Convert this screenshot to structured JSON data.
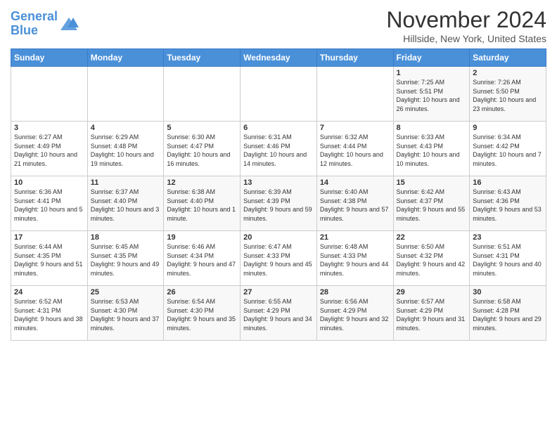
{
  "header": {
    "logo_line1": "General",
    "logo_line2": "Blue",
    "month": "November 2024",
    "location": "Hillside, New York, United States"
  },
  "days_of_week": [
    "Sunday",
    "Monday",
    "Tuesday",
    "Wednesday",
    "Thursday",
    "Friday",
    "Saturday"
  ],
  "weeks": [
    [
      {
        "num": "",
        "info": ""
      },
      {
        "num": "",
        "info": ""
      },
      {
        "num": "",
        "info": ""
      },
      {
        "num": "",
        "info": ""
      },
      {
        "num": "",
        "info": ""
      },
      {
        "num": "1",
        "info": "Sunrise: 7:25 AM\nSunset: 5:51 PM\nDaylight: 10 hours and 26 minutes."
      },
      {
        "num": "2",
        "info": "Sunrise: 7:26 AM\nSunset: 5:50 PM\nDaylight: 10 hours and 23 minutes."
      }
    ],
    [
      {
        "num": "3",
        "info": "Sunrise: 6:27 AM\nSunset: 4:49 PM\nDaylight: 10 hours and 21 minutes."
      },
      {
        "num": "4",
        "info": "Sunrise: 6:29 AM\nSunset: 4:48 PM\nDaylight: 10 hours and 19 minutes."
      },
      {
        "num": "5",
        "info": "Sunrise: 6:30 AM\nSunset: 4:47 PM\nDaylight: 10 hours and 16 minutes."
      },
      {
        "num": "6",
        "info": "Sunrise: 6:31 AM\nSunset: 4:46 PM\nDaylight: 10 hours and 14 minutes."
      },
      {
        "num": "7",
        "info": "Sunrise: 6:32 AM\nSunset: 4:44 PM\nDaylight: 10 hours and 12 minutes."
      },
      {
        "num": "8",
        "info": "Sunrise: 6:33 AM\nSunset: 4:43 PM\nDaylight: 10 hours and 10 minutes."
      },
      {
        "num": "9",
        "info": "Sunrise: 6:34 AM\nSunset: 4:42 PM\nDaylight: 10 hours and 7 minutes."
      }
    ],
    [
      {
        "num": "10",
        "info": "Sunrise: 6:36 AM\nSunset: 4:41 PM\nDaylight: 10 hours and 5 minutes."
      },
      {
        "num": "11",
        "info": "Sunrise: 6:37 AM\nSunset: 4:40 PM\nDaylight: 10 hours and 3 minutes."
      },
      {
        "num": "12",
        "info": "Sunrise: 6:38 AM\nSunset: 4:40 PM\nDaylight: 10 hours and 1 minute."
      },
      {
        "num": "13",
        "info": "Sunrise: 6:39 AM\nSunset: 4:39 PM\nDaylight: 9 hours and 59 minutes."
      },
      {
        "num": "14",
        "info": "Sunrise: 6:40 AM\nSunset: 4:38 PM\nDaylight: 9 hours and 57 minutes."
      },
      {
        "num": "15",
        "info": "Sunrise: 6:42 AM\nSunset: 4:37 PM\nDaylight: 9 hours and 55 minutes."
      },
      {
        "num": "16",
        "info": "Sunrise: 6:43 AM\nSunset: 4:36 PM\nDaylight: 9 hours and 53 minutes."
      }
    ],
    [
      {
        "num": "17",
        "info": "Sunrise: 6:44 AM\nSunset: 4:35 PM\nDaylight: 9 hours and 51 minutes."
      },
      {
        "num": "18",
        "info": "Sunrise: 6:45 AM\nSunset: 4:35 PM\nDaylight: 9 hours and 49 minutes."
      },
      {
        "num": "19",
        "info": "Sunrise: 6:46 AM\nSunset: 4:34 PM\nDaylight: 9 hours and 47 minutes."
      },
      {
        "num": "20",
        "info": "Sunrise: 6:47 AM\nSunset: 4:33 PM\nDaylight: 9 hours and 45 minutes."
      },
      {
        "num": "21",
        "info": "Sunrise: 6:48 AM\nSunset: 4:33 PM\nDaylight: 9 hours and 44 minutes."
      },
      {
        "num": "22",
        "info": "Sunrise: 6:50 AM\nSunset: 4:32 PM\nDaylight: 9 hours and 42 minutes."
      },
      {
        "num": "23",
        "info": "Sunrise: 6:51 AM\nSunset: 4:31 PM\nDaylight: 9 hours and 40 minutes."
      }
    ],
    [
      {
        "num": "24",
        "info": "Sunrise: 6:52 AM\nSunset: 4:31 PM\nDaylight: 9 hours and 38 minutes."
      },
      {
        "num": "25",
        "info": "Sunrise: 6:53 AM\nSunset: 4:30 PM\nDaylight: 9 hours and 37 minutes."
      },
      {
        "num": "26",
        "info": "Sunrise: 6:54 AM\nSunset: 4:30 PM\nDaylight: 9 hours and 35 minutes."
      },
      {
        "num": "27",
        "info": "Sunrise: 6:55 AM\nSunset: 4:29 PM\nDaylight: 9 hours and 34 minutes."
      },
      {
        "num": "28",
        "info": "Sunrise: 6:56 AM\nSunset: 4:29 PM\nDaylight: 9 hours and 32 minutes."
      },
      {
        "num": "29",
        "info": "Sunrise: 6:57 AM\nSunset: 4:29 PM\nDaylight: 9 hours and 31 minutes."
      },
      {
        "num": "30",
        "info": "Sunrise: 6:58 AM\nSunset: 4:28 PM\nDaylight: 9 hours and 29 minutes."
      }
    ]
  ]
}
